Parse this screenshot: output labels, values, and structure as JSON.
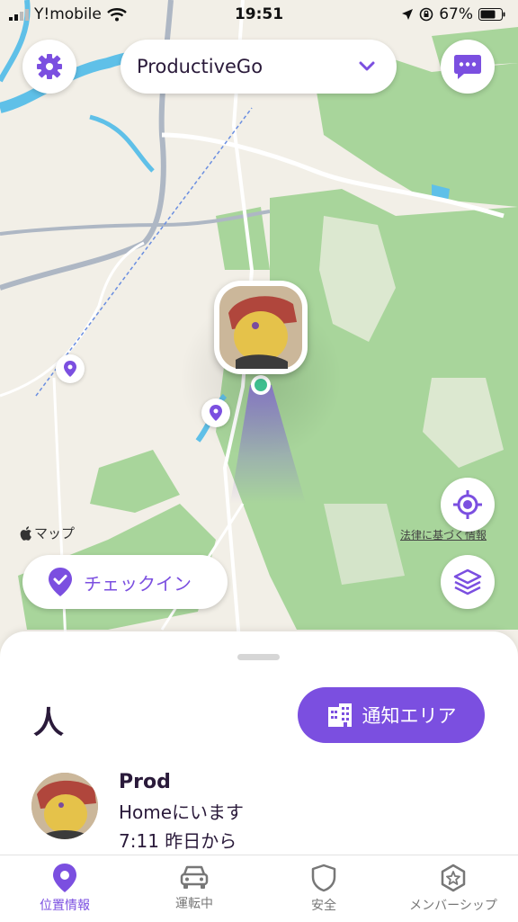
{
  "status_bar": {
    "carrier": "Y!mobile",
    "time": "19:51",
    "battery": "67%"
  },
  "header": {
    "circle_name": "ProductiveGo"
  },
  "map": {
    "attribution": "マップ",
    "legal": "法律に基づく情報"
  },
  "checkin": {
    "label": "チェックイン"
  },
  "sheet": {
    "title": "人",
    "notify_button": "通知エリア",
    "members": [
      {
        "name": "Prod",
        "location": "Homeにいます",
        "since": "7:11 昨日から"
      }
    ]
  },
  "tabs": [
    {
      "label": "位置情報",
      "icon": "location-pin-icon",
      "active": true
    },
    {
      "label": "運転中",
      "icon": "car-icon",
      "active": false
    },
    {
      "label": "安全",
      "icon": "shield-icon",
      "active": false
    },
    {
      "label": "メンバーシップ",
      "icon": "star-badge-icon",
      "active": false
    }
  ],
  "colors": {
    "accent": "#7b4fe0",
    "forest": "#a8d59b",
    "land": "#f2efe7",
    "water": "#5fc0e8",
    "road": "#aeb7c4"
  }
}
